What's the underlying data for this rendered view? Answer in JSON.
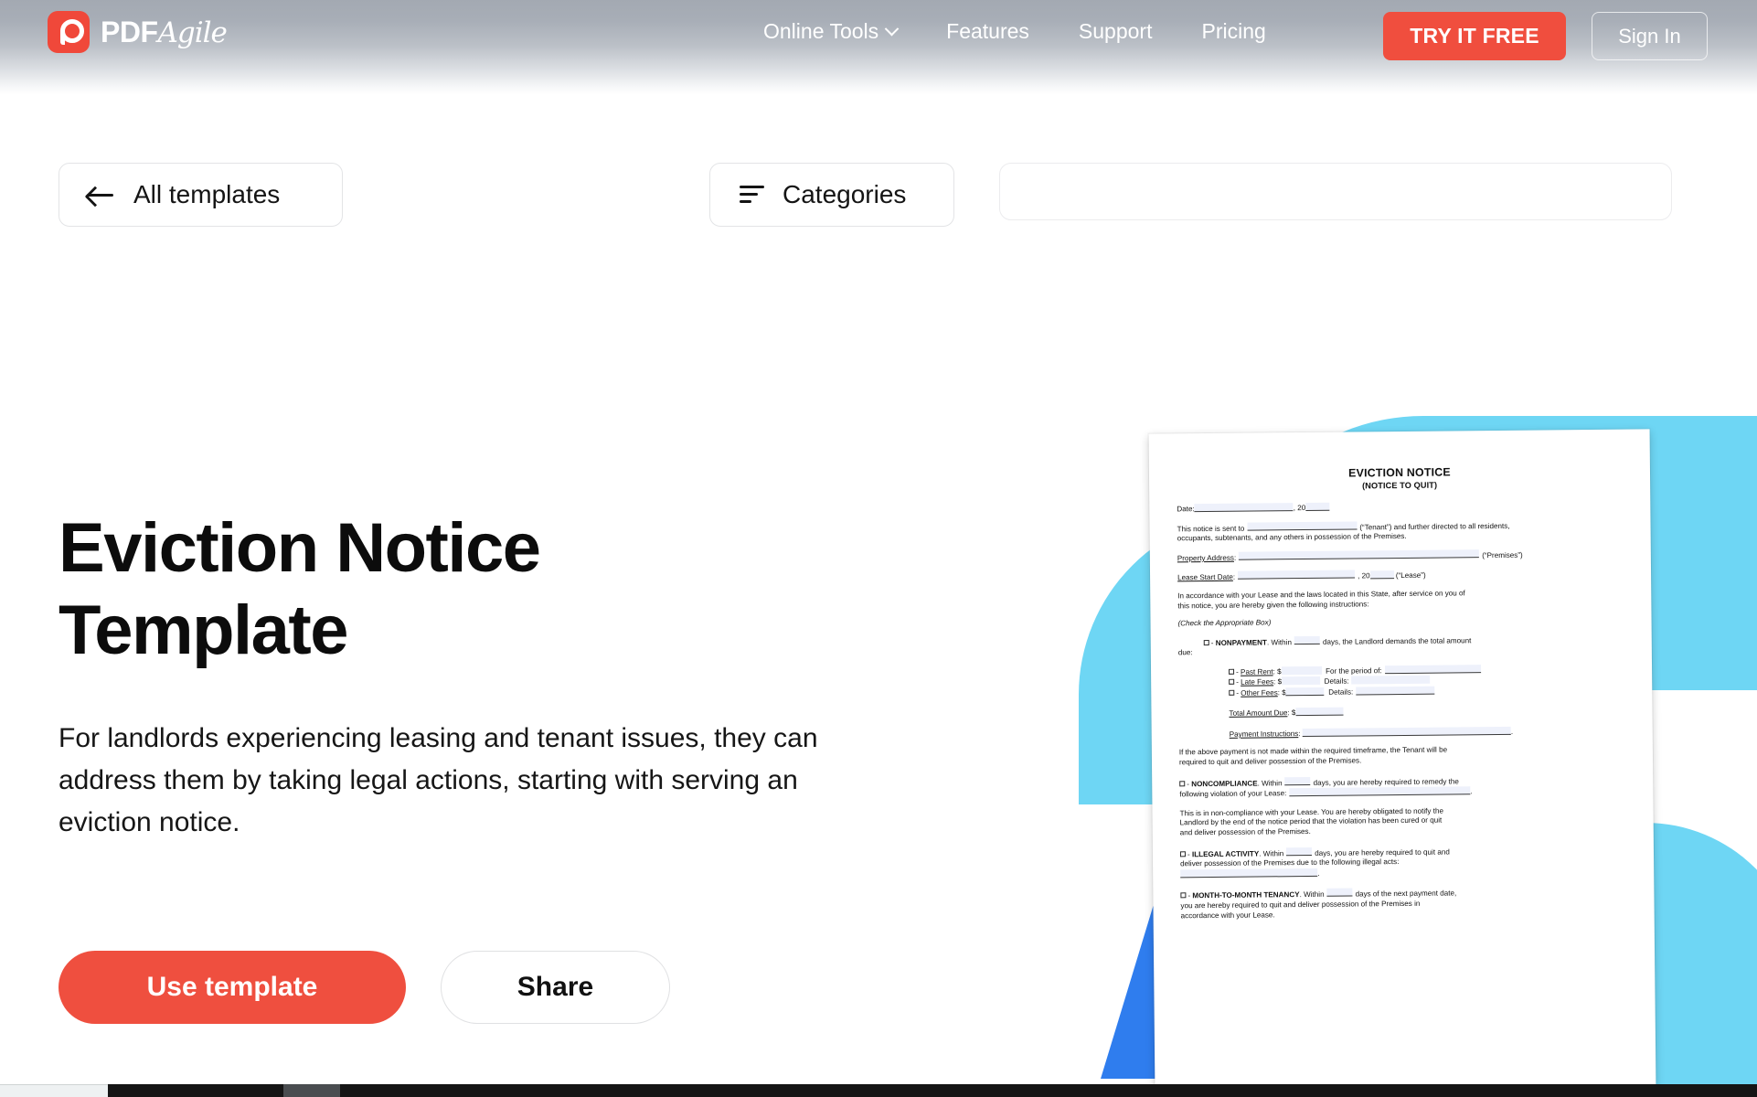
{
  "header": {
    "logo": {
      "brand_bold": "PDF",
      "brand_script": "Agile",
      "icon": "pdfagile-logo-icon"
    },
    "nav": [
      {
        "label": "Online Tools",
        "has_dropdown": true
      },
      {
        "label": "Features",
        "has_dropdown": false
      },
      {
        "label": "Support",
        "has_dropdown": false
      },
      {
        "label": "Pricing",
        "has_dropdown": false
      }
    ],
    "try_free_label": "TRY IT FREE",
    "sign_in_label": "Sign In",
    "accent_color": "#f04e3e"
  },
  "toolbar": {
    "back_label": "All templates",
    "categories_label": "Categories",
    "search_value": "",
    "search_placeholder": ""
  },
  "hero": {
    "title": "Eviction Notice Template",
    "description": "For landlords experiencing leasing and tenant issues, they can address them by taking legal actions, starting with serving an eviction notice.",
    "primary_cta": "Use template",
    "secondary_cta": "Share"
  },
  "decor": {
    "cyan": "#6ed6f4",
    "blue": "#2f7dee"
  },
  "document": {
    "title": "EVICTION NOTICE",
    "subtitle": "(NOTICE TO QUIT)",
    "date_label": "Date:",
    "date_year_prefix": ", 20",
    "sent_to_1": "This notice is sent to",
    "sent_to_2": "(“Tenant”) and further directed to all residents,",
    "sent_to_3": "occupants, subtenants, and any others in possession of the Premises.",
    "property_address_label": "Property Address",
    "premises_tag": "(“Premises”)",
    "lease_start_label": "Lease Start Date",
    "lease_tag": "(“Lease”)",
    "accordance_1": "In accordance with your Lease and the laws located in this State, after service on you of",
    "accordance_2": "this notice, you are hereby given the following instructions:",
    "check_box_note": "(Check the Appropriate Box)",
    "nonpayment_label": "NONPAYMENT",
    "nonpayment_1": ". Within",
    "nonpayment_2": "days, the Landlord demands the total amount",
    "nonpayment_3": "due:",
    "past_rent_label": "Past Rent",
    "late_fees_label": "Late Fees",
    "other_fees_label": "Other Fees",
    "for_period_label": "For the period of:",
    "details_label": "Details:",
    "total_amount_label": "Total Amount Due",
    "payment_instructions_label": "Payment Instructions",
    "timeframe_1": "If the above payment is not made within the required timeframe, the Tenant will be",
    "timeframe_2": "required to quit and deliver possession of the Premises.",
    "noncompliance_label": "NONCOMPLIANCE",
    "noncompliance_1": ". Within",
    "noncompliance_2": "days, you are hereby required to remedy the",
    "noncompliance_3": "following violation of your Lease:",
    "noncompliance_body_1": "This is in non-compliance with your Lease. You are hereby obligated to notify the",
    "noncompliance_body_2": "Landlord by the end of the notice period that the violation has been cured or quit",
    "noncompliance_body_3": "and deliver possession of the Premises.",
    "illegal_label": "ILLEGAL ACTIVITY",
    "illegal_1": ". Within",
    "illegal_2": "days, you are hereby required to quit and",
    "illegal_3": "deliver possession of the Premises due to the following illegal acts:",
    "mtm_label": "MONTH-TO-MONTH TENANCY",
    "mtm_1": ". Within",
    "mtm_2": "days of the next payment date,",
    "mtm_3": "you are hereby required to quit and deliver possession of the Premises in",
    "mtm_4": "accordance with your Lease.",
    "within_days_word": "days",
    "dollar": "$"
  }
}
